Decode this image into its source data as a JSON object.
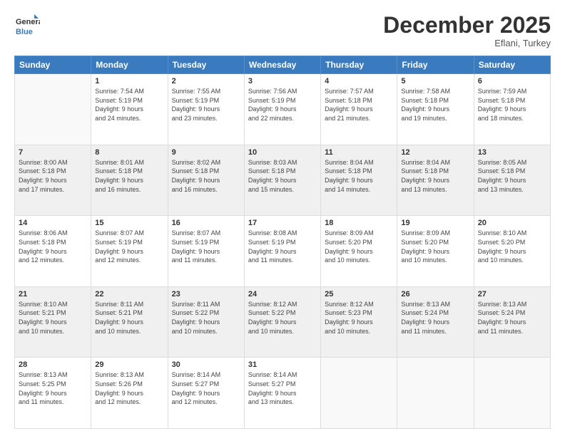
{
  "header": {
    "logo_general": "General",
    "logo_blue": "Blue",
    "month": "December 2025",
    "location": "Eflani, Turkey"
  },
  "weekdays": [
    "Sunday",
    "Monday",
    "Tuesday",
    "Wednesday",
    "Thursday",
    "Friday",
    "Saturday"
  ],
  "weeks": [
    [
      {
        "num": "",
        "info": ""
      },
      {
        "num": "1",
        "info": "Sunrise: 7:54 AM\nSunset: 5:19 PM\nDaylight: 9 hours\nand 24 minutes."
      },
      {
        "num": "2",
        "info": "Sunrise: 7:55 AM\nSunset: 5:19 PM\nDaylight: 9 hours\nand 23 minutes."
      },
      {
        "num": "3",
        "info": "Sunrise: 7:56 AM\nSunset: 5:19 PM\nDaylight: 9 hours\nand 22 minutes."
      },
      {
        "num": "4",
        "info": "Sunrise: 7:57 AM\nSunset: 5:18 PM\nDaylight: 9 hours\nand 21 minutes."
      },
      {
        "num": "5",
        "info": "Sunrise: 7:58 AM\nSunset: 5:18 PM\nDaylight: 9 hours\nand 19 minutes."
      },
      {
        "num": "6",
        "info": "Sunrise: 7:59 AM\nSunset: 5:18 PM\nDaylight: 9 hours\nand 18 minutes."
      }
    ],
    [
      {
        "num": "7",
        "info": "Sunrise: 8:00 AM\nSunset: 5:18 PM\nDaylight: 9 hours\nand 17 minutes."
      },
      {
        "num": "8",
        "info": "Sunrise: 8:01 AM\nSunset: 5:18 PM\nDaylight: 9 hours\nand 16 minutes."
      },
      {
        "num": "9",
        "info": "Sunrise: 8:02 AM\nSunset: 5:18 PM\nDaylight: 9 hours\nand 16 minutes."
      },
      {
        "num": "10",
        "info": "Sunrise: 8:03 AM\nSunset: 5:18 PM\nDaylight: 9 hours\nand 15 minutes."
      },
      {
        "num": "11",
        "info": "Sunrise: 8:04 AM\nSunset: 5:18 PM\nDaylight: 9 hours\nand 14 minutes."
      },
      {
        "num": "12",
        "info": "Sunrise: 8:04 AM\nSunset: 5:18 PM\nDaylight: 9 hours\nand 13 minutes."
      },
      {
        "num": "13",
        "info": "Sunrise: 8:05 AM\nSunset: 5:18 PM\nDaylight: 9 hours\nand 13 minutes."
      }
    ],
    [
      {
        "num": "14",
        "info": "Sunrise: 8:06 AM\nSunset: 5:18 PM\nDaylight: 9 hours\nand 12 minutes."
      },
      {
        "num": "15",
        "info": "Sunrise: 8:07 AM\nSunset: 5:19 PM\nDaylight: 9 hours\nand 12 minutes."
      },
      {
        "num": "16",
        "info": "Sunrise: 8:07 AM\nSunset: 5:19 PM\nDaylight: 9 hours\nand 11 minutes."
      },
      {
        "num": "17",
        "info": "Sunrise: 8:08 AM\nSunset: 5:19 PM\nDaylight: 9 hours\nand 11 minutes."
      },
      {
        "num": "18",
        "info": "Sunrise: 8:09 AM\nSunset: 5:20 PM\nDaylight: 9 hours\nand 10 minutes."
      },
      {
        "num": "19",
        "info": "Sunrise: 8:09 AM\nSunset: 5:20 PM\nDaylight: 9 hours\nand 10 minutes."
      },
      {
        "num": "20",
        "info": "Sunrise: 8:10 AM\nSunset: 5:20 PM\nDaylight: 9 hours\nand 10 minutes."
      }
    ],
    [
      {
        "num": "21",
        "info": "Sunrise: 8:10 AM\nSunset: 5:21 PM\nDaylight: 9 hours\nand 10 minutes."
      },
      {
        "num": "22",
        "info": "Sunrise: 8:11 AM\nSunset: 5:21 PM\nDaylight: 9 hours\nand 10 minutes."
      },
      {
        "num": "23",
        "info": "Sunrise: 8:11 AM\nSunset: 5:22 PM\nDaylight: 9 hours\nand 10 minutes."
      },
      {
        "num": "24",
        "info": "Sunrise: 8:12 AM\nSunset: 5:22 PM\nDaylight: 9 hours\nand 10 minutes."
      },
      {
        "num": "25",
        "info": "Sunrise: 8:12 AM\nSunset: 5:23 PM\nDaylight: 9 hours\nand 10 minutes."
      },
      {
        "num": "26",
        "info": "Sunrise: 8:13 AM\nSunset: 5:24 PM\nDaylight: 9 hours\nand 11 minutes."
      },
      {
        "num": "27",
        "info": "Sunrise: 8:13 AM\nSunset: 5:24 PM\nDaylight: 9 hours\nand 11 minutes."
      }
    ],
    [
      {
        "num": "28",
        "info": "Sunrise: 8:13 AM\nSunset: 5:25 PM\nDaylight: 9 hours\nand 11 minutes."
      },
      {
        "num": "29",
        "info": "Sunrise: 8:13 AM\nSunset: 5:26 PM\nDaylight: 9 hours\nand 12 minutes."
      },
      {
        "num": "30",
        "info": "Sunrise: 8:14 AM\nSunset: 5:27 PM\nDaylight: 9 hours\nand 12 minutes."
      },
      {
        "num": "31",
        "info": "Sunrise: 8:14 AM\nSunset: 5:27 PM\nDaylight: 9 hours\nand 13 minutes."
      },
      {
        "num": "",
        "info": ""
      },
      {
        "num": "",
        "info": ""
      },
      {
        "num": "",
        "info": ""
      }
    ]
  ]
}
